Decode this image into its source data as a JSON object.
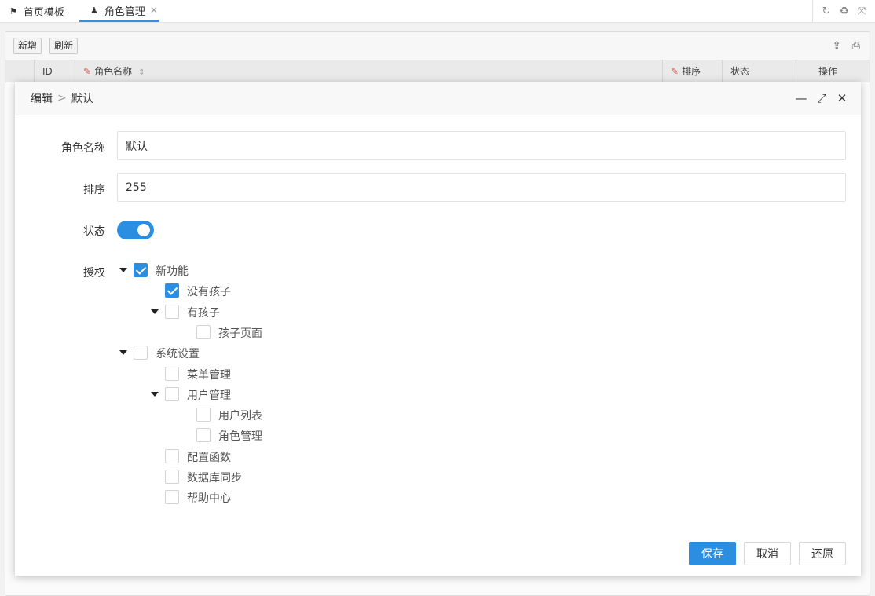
{
  "tabs": [
    {
      "label": "首页模板",
      "icon": "flag-icon",
      "active": false
    },
    {
      "label": "角色管理",
      "icon": "person-icon",
      "active": true
    }
  ],
  "toolbar": {
    "add_label": "新增",
    "refresh_label": "刷新"
  },
  "table": {
    "columns": [
      "ID",
      "角色名称",
      "排序",
      "状态",
      "操作"
    ]
  },
  "dialog": {
    "title_prefix": "编辑",
    "title_sep": ">",
    "title_name": "默认",
    "fields": {
      "role_name_label": "角色名称",
      "role_name_value": "默认",
      "sort_label": "排序",
      "sort_value": "255",
      "status_label": "状态",
      "status_on": true,
      "auth_label": "授权"
    },
    "tree": [
      {
        "label": "新功能",
        "checked": true,
        "expanded": true,
        "level": 0
      },
      {
        "label": "没有孩子",
        "checked": true,
        "expanded": null,
        "level": 1
      },
      {
        "label": "有孩子",
        "checked": false,
        "expanded": true,
        "level": 1
      },
      {
        "label": "孩子页面",
        "checked": false,
        "expanded": null,
        "level": 2
      },
      {
        "label": "系统设置",
        "checked": false,
        "expanded": true,
        "level": 0
      },
      {
        "label": "菜单管理",
        "checked": false,
        "expanded": null,
        "level": 1
      },
      {
        "label": "用户管理",
        "checked": false,
        "expanded": true,
        "level": 1
      },
      {
        "label": "用户列表",
        "checked": false,
        "expanded": null,
        "level": 2
      },
      {
        "label": "角色管理",
        "checked": false,
        "expanded": null,
        "level": 2
      },
      {
        "label": "配置函数",
        "checked": false,
        "expanded": null,
        "level": 1
      },
      {
        "label": "数据库同步",
        "checked": false,
        "expanded": null,
        "level": 1
      },
      {
        "label": "帮助中心",
        "checked": false,
        "expanded": null,
        "level": 1
      }
    ],
    "buttons": {
      "save": "保存",
      "cancel": "取消",
      "reset": "还原"
    }
  },
  "colors": {
    "accent": "#2b8ee0"
  }
}
